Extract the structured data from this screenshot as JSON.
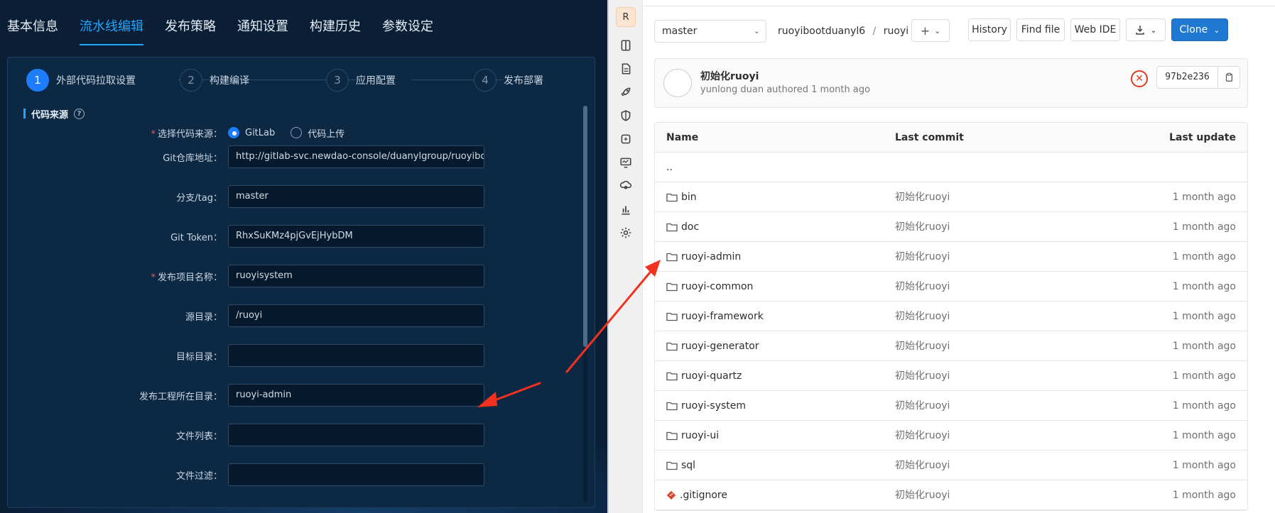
{
  "pipeline": {
    "tabs": [
      "基本信息",
      "流水线编辑",
      "发布策略",
      "通知设置",
      "构建历史",
      "参数设定"
    ],
    "active_tab_index": 1,
    "steps": [
      {
        "num": "1",
        "label": "外部代码拉取设置"
      },
      {
        "num": "2",
        "label": "构建编译"
      },
      {
        "num": "3",
        "label": "应用配置"
      },
      {
        "num": "4",
        "label": "发布部署"
      }
    ],
    "active_step_index": 0,
    "section_title": "代码来源",
    "help_glyph": "?",
    "form": {
      "source_label": "选择代码来源",
      "source_options": [
        "GitLab",
        "代码上传"
      ],
      "source_selected": "GitLab",
      "repo_label": "Git仓库地址",
      "repo_value": "http://gitlab-svc.newdao-console/duanylgroup/ruoyiboo",
      "branch_label": "分支/tag",
      "branch_value": "master",
      "token_label": "Git Token",
      "token_value": "RhxSuKMz4pjGvEjHybDM",
      "project_label": "发布项目名称",
      "project_value": "ruoyisystem",
      "src_dir_label": "源目录",
      "src_dir_value": "/ruoyi",
      "target_dir_label": "目标目录",
      "target_dir_value": "",
      "publish_dir_label": "发布工程所在目录",
      "publish_dir_value": "ruoyi-admin",
      "file_list_label": "文件列表",
      "file_list_value": "",
      "file_filter_label": "文件过滤",
      "file_filter_value": ""
    }
  },
  "gitlab": {
    "project_avatar_letter": "R",
    "sidebar_icons": [
      "repository-icon",
      "issues-icon",
      "rocket-icon",
      "shield-icon",
      "deployments-icon",
      "monitor-icon",
      "infrastructure-icon",
      "analytics-icon",
      "settings-icon"
    ],
    "branch": "master",
    "breadcrumb": [
      "ruoyibootduanyl6",
      "ruoyi"
    ],
    "breadcrumb_sep": "/",
    "add_glyph": "+",
    "buttons": {
      "history": "History",
      "find_file": "Find file",
      "web_ide": "Web IDE",
      "clone": "Clone"
    },
    "commit": {
      "title": "初始化ruoyi",
      "author_line": "yunlong duan authored 1 month ago",
      "sha": "97b2e236",
      "pipeline_status": "failed"
    },
    "table": {
      "headers": [
        "Name",
        "Last commit",
        "Last update"
      ],
      "parent_dir": "..",
      "rows": [
        {
          "name": "bin",
          "type": "folder",
          "commit": "初始化ruoyi",
          "updated": "1 month ago"
        },
        {
          "name": "doc",
          "type": "folder",
          "commit": "初始化ruoyi",
          "updated": "1 month ago"
        },
        {
          "name": "ruoyi-admin",
          "type": "folder",
          "commit": "初始化ruoyi",
          "updated": "1 month ago"
        },
        {
          "name": "ruoyi-common",
          "type": "folder",
          "commit": "初始化ruoyi",
          "updated": "1 month ago"
        },
        {
          "name": "ruoyi-framework",
          "type": "folder",
          "commit": "初始化ruoyi",
          "updated": "1 month ago"
        },
        {
          "name": "ruoyi-generator",
          "type": "folder",
          "commit": "初始化ruoyi",
          "updated": "1 month ago"
        },
        {
          "name": "ruoyi-quartz",
          "type": "folder",
          "commit": "初始化ruoyi",
          "updated": "1 month ago"
        },
        {
          "name": "ruoyi-system",
          "type": "folder",
          "commit": "初始化ruoyi",
          "updated": "1 month ago"
        },
        {
          "name": "ruoyi-ui",
          "type": "folder",
          "commit": "初始化ruoyi",
          "updated": "1 month ago"
        },
        {
          "name": "sql",
          "type": "folder",
          "commit": "初始化ruoyi",
          "updated": "1 month ago"
        },
        {
          "name": ".gitignore",
          "type": "git-file",
          "commit": "初始化ruoyi",
          "updated": "1 month ago"
        }
      ]
    }
  },
  "colors": {
    "left_bg": "#0a1e36",
    "accent": "#1ea7ff",
    "arrow": "#f2321e",
    "clone_btn": "#1f78d1"
  }
}
